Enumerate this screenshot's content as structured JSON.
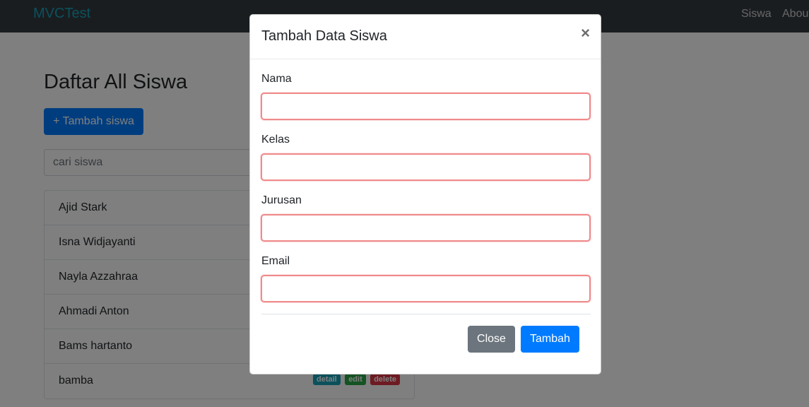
{
  "navbar": {
    "brand": "MVCTest",
    "links": [
      "Siswa",
      "About"
    ]
  },
  "main": {
    "title": "Daftar All Siswa",
    "add_button": "+ Tambah siswa",
    "search_placeholder": "cari siswa",
    "students": [
      "Ajid Stark",
      "Isna Widjayanti",
      "Nayla Azzahraa",
      "Ahmadi Anton",
      "Bams hartanto",
      "bamba"
    ],
    "badges": {
      "detail": "detail",
      "edit": "edit",
      "delete": "delete"
    }
  },
  "modal": {
    "title": "Tambah Data Siswa",
    "close_symbol": "×",
    "fields": [
      {
        "label": "Nama",
        "value": ""
      },
      {
        "label": "Kelas",
        "value": ""
      },
      {
        "label": "Jurusan",
        "value": ""
      },
      {
        "label": "Email",
        "value": ""
      }
    ],
    "close_button": "Close",
    "submit_button": "Tambah"
  },
  "colors": {
    "navbar": "#343a40",
    "brand": "#17a2b8",
    "primary": "#007bff",
    "secondary": "#6c757d",
    "invalid_border": "#f08a8a"
  }
}
